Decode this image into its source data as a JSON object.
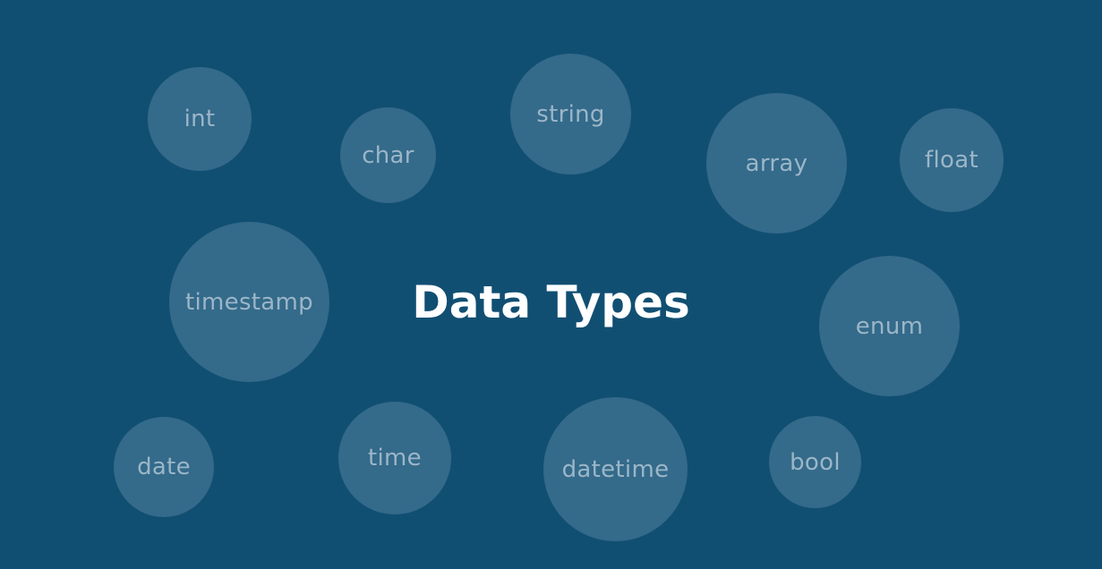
{
  "title": "Data Types",
  "bubbles": {
    "int": "int",
    "char": "char",
    "string": "string",
    "array": "array",
    "float": "float",
    "timestamp": "timestamp",
    "enum": "enum",
    "date": "date",
    "time": "time",
    "datetime": "datetime",
    "bool": "bool"
  },
  "colors": {
    "background": "#114f72",
    "bubble": "#346a8a",
    "bubble_text": "#9bb6c8",
    "title_text": "#ffffff"
  }
}
